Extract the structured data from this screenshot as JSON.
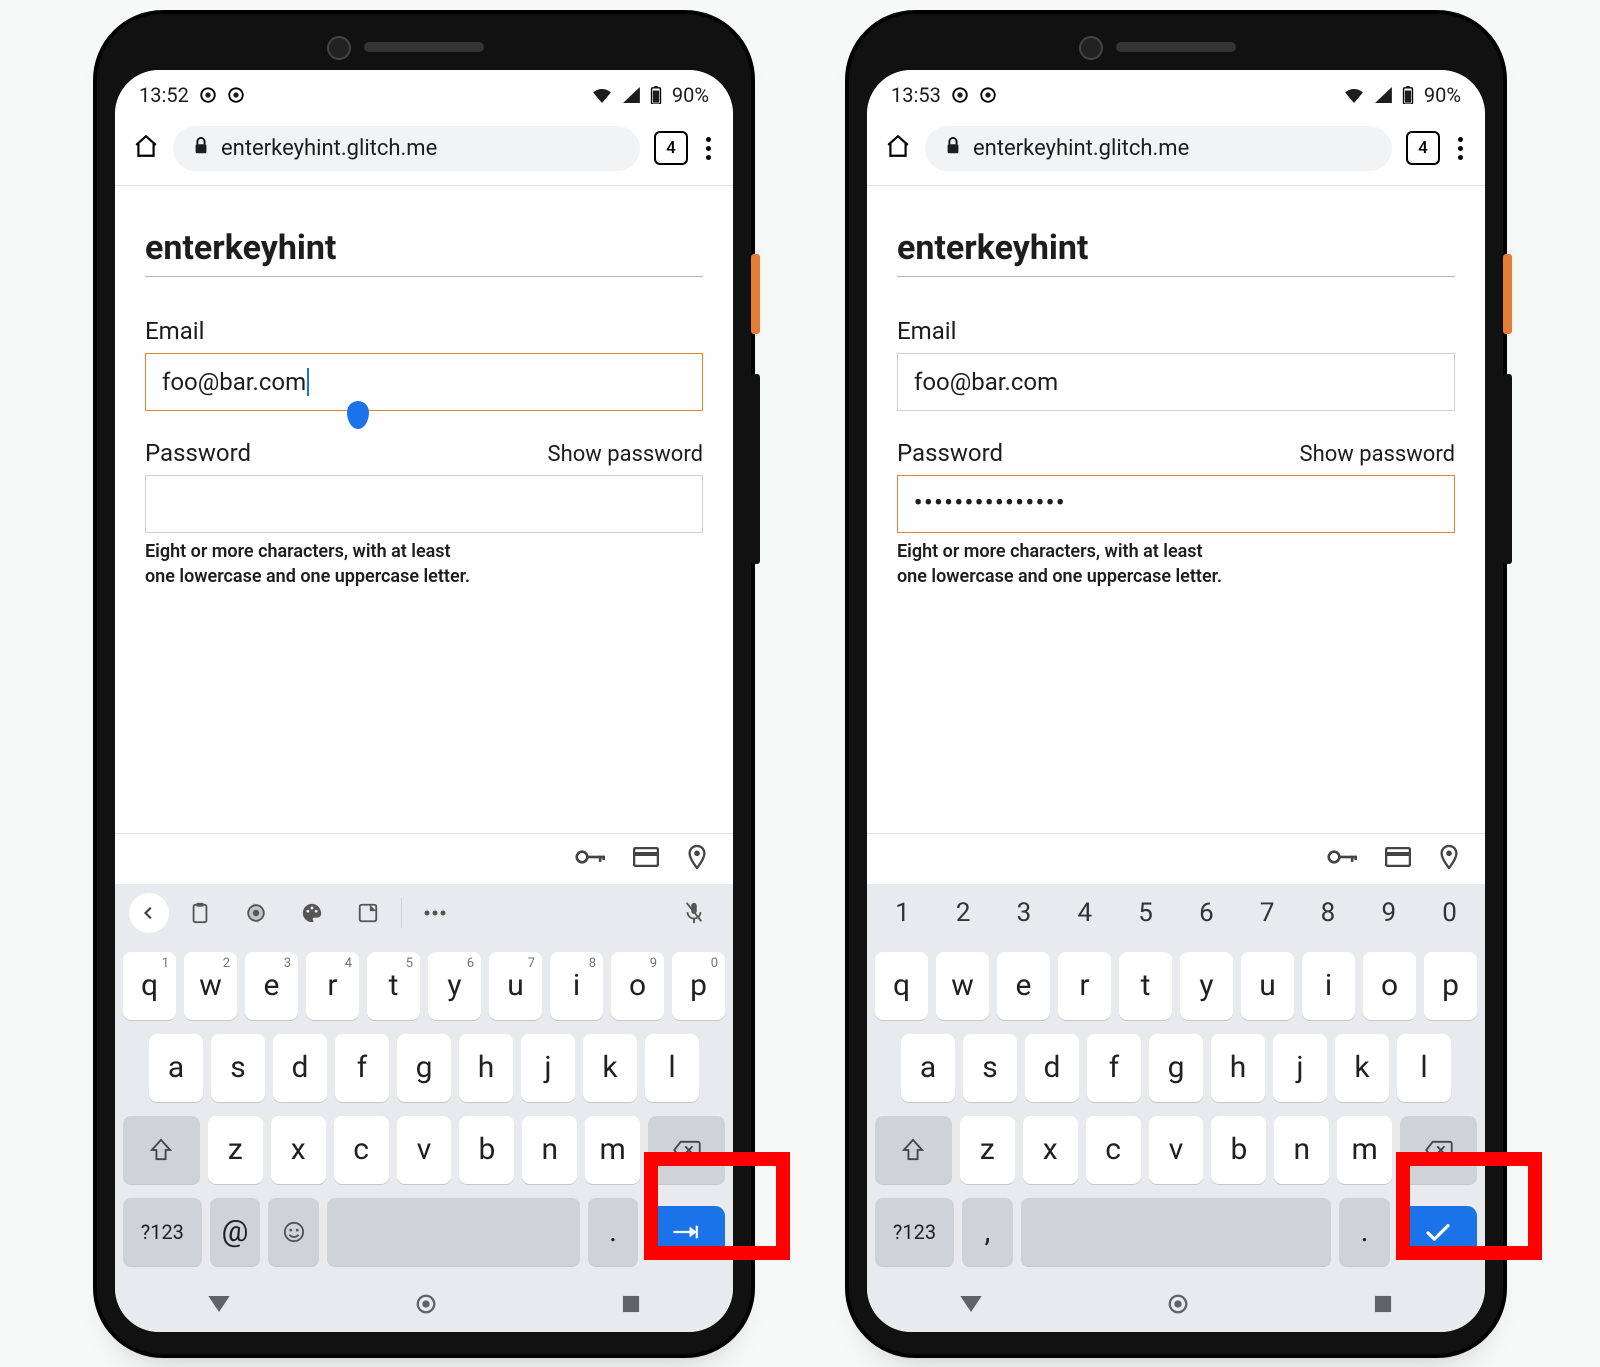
{
  "phones": [
    {
      "statusbar": {
        "time": "13:52",
        "battery": "90%"
      },
      "chrome": {
        "url": "enterkeyhint.glitch.me",
        "tab_count": "4"
      },
      "page": {
        "title": "enterkeyhint",
        "email_label": "Email",
        "email_value": "foo@bar.com",
        "email_focused": true,
        "password_label": "Password",
        "show_password": "Show password",
        "password_value": "",
        "password_focused": false,
        "hint_l1": "Eight or more characters, with at least",
        "hint_l2": "one lowercase and one uppercase letter."
      },
      "keyboard": {
        "variant": "toolbar",
        "qwerty_sup": [
          "1",
          "2",
          "3",
          "4",
          "5",
          "6",
          "7",
          "8",
          "9",
          "0"
        ],
        "row1": [
          "q",
          "w",
          "e",
          "r",
          "t",
          "y",
          "u",
          "i",
          "o",
          "p"
        ],
        "row2": [
          "a",
          "s",
          "d",
          "f",
          "g",
          "h",
          "j",
          "k",
          "l"
        ],
        "row3": [
          "z",
          "x",
          "c",
          "v",
          "b",
          "n",
          "m"
        ],
        "sym_label": "?123",
        "extra_left": "@",
        "extra_right": ".",
        "enter_kind": "next"
      }
    },
    {
      "statusbar": {
        "time": "13:53",
        "battery": "90%"
      },
      "chrome": {
        "url": "enterkeyhint.glitch.me",
        "tab_count": "4"
      },
      "page": {
        "title": "enterkeyhint",
        "email_label": "Email",
        "email_value": "foo@bar.com",
        "email_focused": false,
        "password_label": "Password",
        "show_password": "Show password",
        "password_value": "•••••••••••••••",
        "password_focused": true,
        "hint_l1": "Eight or more characters, with at least",
        "hint_l2": "one lowercase and one uppercase letter."
      },
      "keyboard": {
        "variant": "numrow",
        "numrow": [
          "1",
          "2",
          "3",
          "4",
          "5",
          "6",
          "7",
          "8",
          "9",
          "0"
        ],
        "row1": [
          "q",
          "w",
          "e",
          "r",
          "t",
          "y",
          "u",
          "i",
          "o",
          "p"
        ],
        "row2": [
          "a",
          "s",
          "d",
          "f",
          "g",
          "h",
          "j",
          "k",
          "l"
        ],
        "row3": [
          "z",
          "x",
          "c",
          "v",
          "b",
          "n",
          "m"
        ],
        "sym_label": "?123",
        "extra_left": ",",
        "extra_right": ".",
        "enter_kind": "done"
      }
    }
  ]
}
